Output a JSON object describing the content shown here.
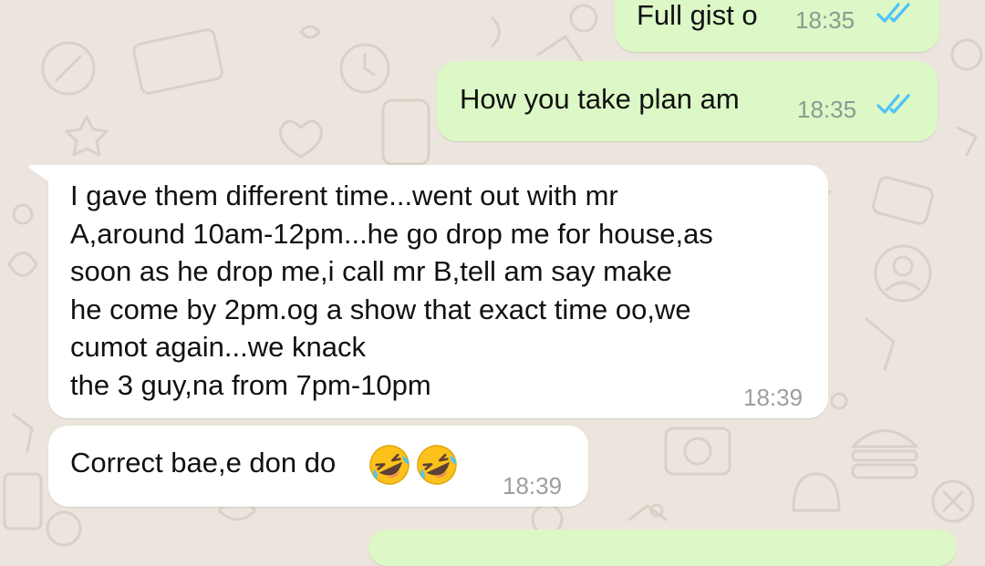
{
  "colors": {
    "background": "#ece5dd",
    "outgoing_bubble": "#dcf8c6",
    "incoming_bubble": "#ffffff",
    "read_ticks": "#4fc3f7"
  },
  "messages": [
    {
      "direction": "outgoing",
      "text": "Full gist o",
      "time": "18:35",
      "status_icon": "double-check-read-icon"
    },
    {
      "direction": "outgoing",
      "text": "How you take plan am",
      "time": "18:35",
      "status_icon": "double-check-read-icon"
    },
    {
      "direction": "incoming",
      "lines": [
        "I gave them different time...went out with mr",
        "A,around 10am-12pm...he go drop me for house,as",
        "soon as he drop me,i call mr B,tell am say make",
        "he come by 2pm.og a show that exact time oo,we",
        "cumot again...we knack",
        "the 3 guy,na from 7pm-10pm"
      ],
      "time": "18:39"
    },
    {
      "direction": "incoming",
      "text": "Correct bae,e don do",
      "emojis": [
        "rolling-on-floor-laughing-emoji",
        "rolling-on-floor-laughing-emoji"
      ],
      "time": "18:39"
    }
  ]
}
